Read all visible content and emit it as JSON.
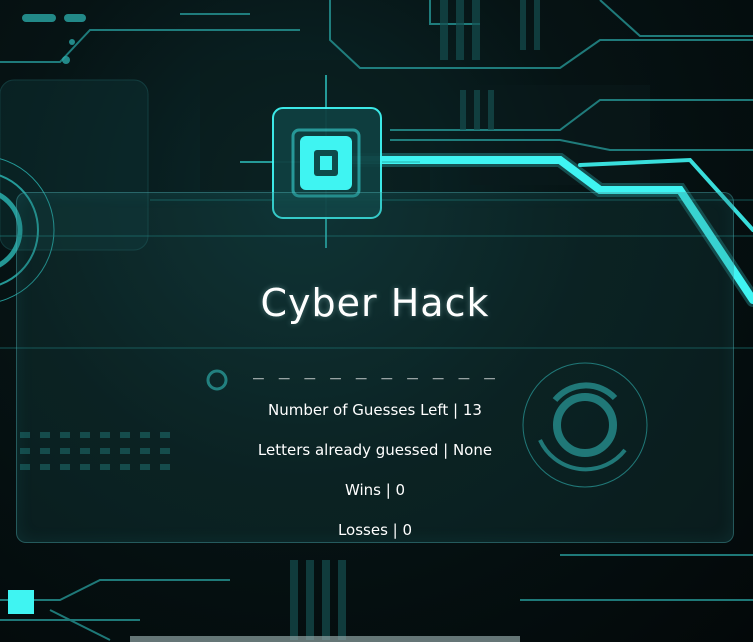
{
  "game": {
    "title": "Cyber Hack",
    "word_display": "_ _ _ _ _ _ _ _ _ _"
  },
  "stats": {
    "guesses_left": "Number of Guesses Left | 13",
    "letters_guessed": "Letters already guessed | None",
    "wins": "Wins | 0",
    "losses": "Losses | 0"
  },
  "colors": {
    "accent": "#3ff4f2",
    "panel": "#1e5a5c",
    "background": "#050b0c",
    "text": "#ffffff"
  },
  "icons": {
    "emblem": "target-chip-icon",
    "dial": "circular-dial-icon",
    "corner": "square-node-icon"
  }
}
